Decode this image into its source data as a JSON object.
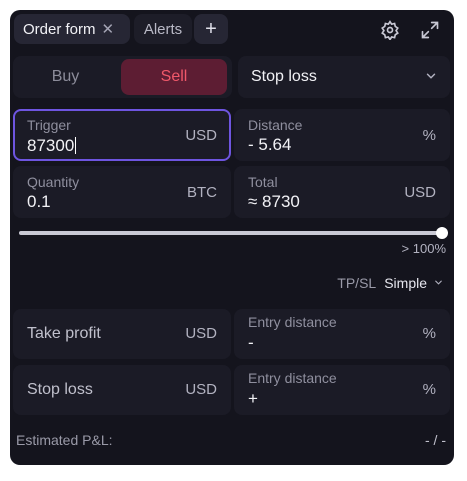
{
  "tabs": {
    "active": "Order form",
    "close": "✕",
    "alerts": "Alerts",
    "add": "+"
  },
  "side": {
    "buy": "Buy",
    "sell": "Sell",
    "selected": "Sell"
  },
  "order_type": {
    "value": "Stop loss"
  },
  "fields": {
    "trigger": {
      "label": "Trigger",
      "value": "87300",
      "unit": "USD"
    },
    "distance": {
      "label": "Distance",
      "value": "-  5.64",
      "unit": "%"
    },
    "quantity": {
      "label": "Quantity",
      "value": "0.1",
      "unit": "BTC"
    },
    "total": {
      "label": "Total",
      "value": "≈ 8730",
      "unit": "USD"
    }
  },
  "slider": {
    "label": "> 100%",
    "value": 1.0
  },
  "tpsl": {
    "label": "TP/SL",
    "mode": "Simple"
  },
  "take_profit": {
    "label": "Take profit",
    "unit": "USD"
  },
  "entry_distance_1": {
    "label": "Entry distance",
    "value": "-",
    "unit": "%"
  },
  "stop_loss": {
    "label": "Stop loss",
    "unit": "USD"
  },
  "entry_distance_2": {
    "label": "Entry distance",
    "value": "+",
    "unit": "%"
  },
  "estimated_pnl": {
    "label": "Estimated P&L:",
    "value": "- / -"
  },
  "colors": {
    "panel": "#14141d",
    "sell_bg": "#5d1d33",
    "sell_text": "#f0586a",
    "focus": "#6e55e0"
  },
  "icons": {
    "settings": "gear-icon",
    "expand": "expand-icon",
    "dropdown": "chevron-down-icon"
  }
}
